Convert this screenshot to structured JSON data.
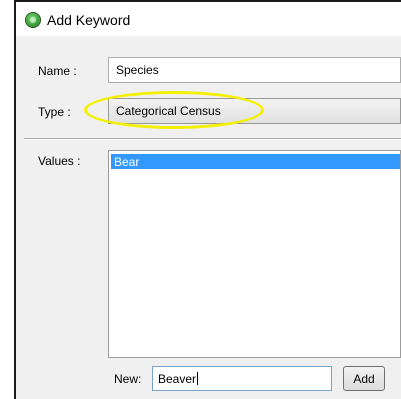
{
  "window": {
    "title": "Add Keyword"
  },
  "form": {
    "name_label": "Name :",
    "name_value": "Species",
    "type_label": "Type :",
    "type_value": "Categorical Census",
    "values_label": "Values :",
    "values": [
      "Bear"
    ],
    "new_label": "New:",
    "new_value": "Beaver",
    "add_label": "Add"
  },
  "colors": {
    "highlight": "#f3f000",
    "selection": "#3399ff",
    "icon": "#3fa33a"
  },
  "icons": {
    "app": "globe-icon"
  }
}
